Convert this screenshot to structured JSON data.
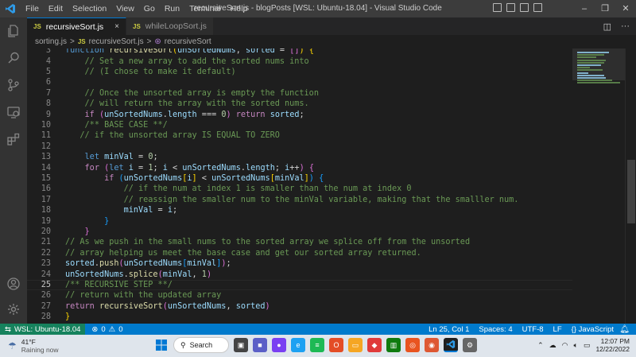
{
  "menu": [
    "File",
    "Edit",
    "Selection",
    "View",
    "Go",
    "Run",
    "Terminal",
    "Help"
  ],
  "window_title": "recursiveSort.js - blogPosts [WSL: Ubuntu-18.04] - Visual Studio Code",
  "tabs": [
    {
      "icon": "JS",
      "label": "recursiveSort.js",
      "close": "×"
    },
    {
      "icon": "JS",
      "label": "whileLoopSort.js"
    }
  ],
  "breadcrumb": {
    "folder": "sorting.js",
    "file": "recursiveSort.js",
    "symbol": "recursiveSort",
    "sep": ">"
  },
  "editor": {
    "lines": [
      {
        "n": "3",
        "tokens": [
          [
            "k",
            "function"
          ],
          [
            "p",
            " "
          ],
          [
            "f",
            "recursiveSort"
          ],
          [
            "b1",
            "("
          ],
          [
            "v",
            "unSortedNums"
          ],
          [
            "p",
            ", "
          ],
          [
            "v",
            "sorted"
          ],
          [
            "p",
            " = "
          ],
          [
            "b2",
            "[]"
          ],
          [
            "b1",
            ")"
          ],
          [
            "p",
            " "
          ],
          [
            "b1",
            "{"
          ]
        ]
      },
      {
        "n": "4",
        "tokens": [
          [
            "p",
            "    "
          ],
          [
            "c",
            "// Set a new array to add the sorted nums into"
          ]
        ]
      },
      {
        "n": "5",
        "tokens": [
          [
            "p",
            "    "
          ],
          [
            "c",
            "// (I chose to make it default)"
          ]
        ]
      },
      {
        "n": "6",
        "tokens": []
      },
      {
        "n": "7",
        "tokens": [
          [
            "p",
            "    "
          ],
          [
            "c",
            "// Once the unsorted array is empty the function"
          ]
        ]
      },
      {
        "n": "8",
        "tokens": [
          [
            "p",
            "    "
          ],
          [
            "c",
            "// will return the array with the sorted nums."
          ]
        ]
      },
      {
        "n": "9",
        "tokens": [
          [
            "p",
            "    "
          ],
          [
            "kc",
            "if"
          ],
          [
            "p",
            " "
          ],
          [
            "b2",
            "("
          ],
          [
            "v",
            "unSortedNums"
          ],
          [
            "p",
            "."
          ],
          [
            "v",
            "length"
          ],
          [
            "p",
            " === "
          ],
          [
            "n",
            "0"
          ],
          [
            "b2",
            ")"
          ],
          [
            "p",
            " "
          ],
          [
            "kc",
            "return"
          ],
          [
            "p",
            " "
          ],
          [
            "v",
            "sorted"
          ],
          [
            "p",
            ";"
          ]
        ]
      },
      {
        "n": "10",
        "tokens": [
          [
            "p",
            "    "
          ],
          [
            "c",
            "/** BASE CASE **/"
          ]
        ]
      },
      {
        "n": "11",
        "tokens": [
          [
            "p",
            "   "
          ],
          [
            "c",
            "// if the unsorted array IS EQUAL TO ZERO"
          ]
        ]
      },
      {
        "n": "12",
        "tokens": []
      },
      {
        "n": "13",
        "tokens": [
          [
            "p",
            "    "
          ],
          [
            "k",
            "let"
          ],
          [
            "p",
            " "
          ],
          [
            "v",
            "minVal"
          ],
          [
            "p",
            " = "
          ],
          [
            "n",
            "0"
          ],
          [
            "p",
            ";"
          ]
        ]
      },
      {
        "n": "14",
        "tokens": [
          [
            "p",
            "    "
          ],
          [
            "kc",
            "for"
          ],
          [
            "p",
            " "
          ],
          [
            "b2",
            "("
          ],
          [
            "k",
            "let"
          ],
          [
            "p",
            " "
          ],
          [
            "v",
            "i"
          ],
          [
            "p",
            " = "
          ],
          [
            "n",
            "1"
          ],
          [
            "p",
            "; "
          ],
          [
            "v",
            "i"
          ],
          [
            "p",
            " < "
          ],
          [
            "v",
            "unSortedNums"
          ],
          [
            "p",
            "."
          ],
          [
            "v",
            "length"
          ],
          [
            "p",
            "; "
          ],
          [
            "v",
            "i"
          ],
          [
            "p",
            "++"
          ],
          [
            "b2",
            ")"
          ],
          [
            "p",
            " "
          ],
          [
            "b2",
            "{"
          ]
        ]
      },
      {
        "n": "15",
        "tokens": [
          [
            "p",
            "        "
          ],
          [
            "kc",
            "if"
          ],
          [
            "p",
            " "
          ],
          [
            "b3",
            "("
          ],
          [
            "v",
            "unSortedNums"
          ],
          [
            "b1",
            "["
          ],
          [
            "v",
            "i"
          ],
          [
            "b1",
            "]"
          ],
          [
            "p",
            " < "
          ],
          [
            "v",
            "unSortedNums"
          ],
          [
            "b1",
            "["
          ],
          [
            "v",
            "minVal"
          ],
          [
            "b1",
            "]"
          ],
          [
            "b3",
            ")"
          ],
          [
            "p",
            " "
          ],
          [
            "b3",
            "{"
          ]
        ]
      },
      {
        "n": "16",
        "tokens": [
          [
            "p",
            "            "
          ],
          [
            "c",
            "// if the num at index 1 is smaller than the num at index 0"
          ]
        ]
      },
      {
        "n": "17",
        "tokens": [
          [
            "p",
            "            "
          ],
          [
            "c",
            "// reassign the smaller num to the minVal variable, making that the smalller num."
          ]
        ]
      },
      {
        "n": "18",
        "tokens": [
          [
            "p",
            "            "
          ],
          [
            "v",
            "minVal"
          ],
          [
            "p",
            " = "
          ],
          [
            "v",
            "i"
          ],
          [
            "p",
            ";"
          ]
        ]
      },
      {
        "n": "19",
        "tokens": [
          [
            "p",
            "        "
          ],
          [
            "b3",
            "}"
          ]
        ]
      },
      {
        "n": "20",
        "tokens": [
          [
            "p",
            "    "
          ],
          [
            "b2",
            "}"
          ]
        ]
      },
      {
        "n": "21",
        "tokens": [
          [
            "c",
            "// As we push in the small nums to the sorted array we splice off from the unsorted"
          ]
        ]
      },
      {
        "n": "22",
        "tokens": [
          [
            "c",
            "// array helping us meet the base case and get our sorted array returned."
          ]
        ]
      },
      {
        "n": "23",
        "tokens": [
          [
            "v",
            "sorted"
          ],
          [
            "p",
            "."
          ],
          [
            "f",
            "push"
          ],
          [
            "b2",
            "("
          ],
          [
            "v",
            "unSortedNums"
          ],
          [
            "b3",
            "["
          ],
          [
            "v",
            "minVal"
          ],
          [
            "b3",
            "]"
          ],
          [
            "b2",
            ")"
          ],
          [
            "p",
            ";"
          ]
        ]
      },
      {
        "n": "24",
        "tokens": [
          [
            "v",
            "unSortedNums"
          ],
          [
            "p",
            "."
          ],
          [
            "f",
            "splice"
          ],
          [
            "b2",
            "("
          ],
          [
            "v",
            "minVal"
          ],
          [
            "p",
            ", "
          ],
          [
            "n",
            "1"
          ],
          [
            "b2",
            ")"
          ]
        ]
      },
      {
        "n": "25",
        "tokens": [
          [
            "c",
            "/** RECURSIVE STEP **/"
          ]
        ],
        "current": true
      },
      {
        "n": "26",
        "tokens": [
          [
            "c",
            "// return with the updated array"
          ]
        ]
      },
      {
        "n": "27",
        "tokens": [
          [
            "kc",
            "return"
          ],
          [
            "p",
            " "
          ],
          [
            "f",
            "recursiveSort"
          ],
          [
            "b2",
            "("
          ],
          [
            "v",
            "unSortedNums"
          ],
          [
            "p",
            ", "
          ],
          [
            "v",
            "sorted"
          ],
          [
            "b2",
            ")"
          ]
        ]
      },
      {
        "n": "28",
        "tokens": [
          [
            "b1",
            "}"
          ]
        ]
      }
    ]
  },
  "status": {
    "remote": "WSL: Ubuntu-18.04",
    "errors": "0",
    "warnings": "0",
    "cursor": "Ln 25, Col 1",
    "spaces": "Spaces: 4",
    "encoding": "UTF-8",
    "eol": "LF",
    "language": "JavaScript"
  },
  "taskbar": {
    "temp": "41°F",
    "weather": "Raining now",
    "search": "Search",
    "time": "12:07 PM",
    "date": "12/22/2022"
  },
  "colors": {
    "status_bar": "#007acc",
    "remote_indicator": "#16825d",
    "editor_bg": "#1e1e1e",
    "comment": "#6a9955",
    "keyword": "#569cd6"
  }
}
